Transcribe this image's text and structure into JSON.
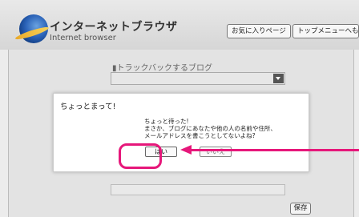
{
  "header": {
    "title_jp": "インターネットブラウザ",
    "title_en": "Internet browser",
    "favorites_button": "お気に入りページ",
    "top_menu_button": "トップメニューへもどる"
  },
  "form": {
    "trackback_label": "▮トラックバックするブログ",
    "save_button": "保存"
  },
  "dialog": {
    "title": "ちょっとまって!",
    "message_line1": "ちょっと待った!",
    "message_line2": "まさか、ブログにあなたや他の人の名前や住所、",
    "message_line3": "メールアドレスを書こうとしてないよね?",
    "yes_button": "はい",
    "no_button": "いいえ"
  },
  "colors": {
    "highlight": "#e6177a"
  }
}
